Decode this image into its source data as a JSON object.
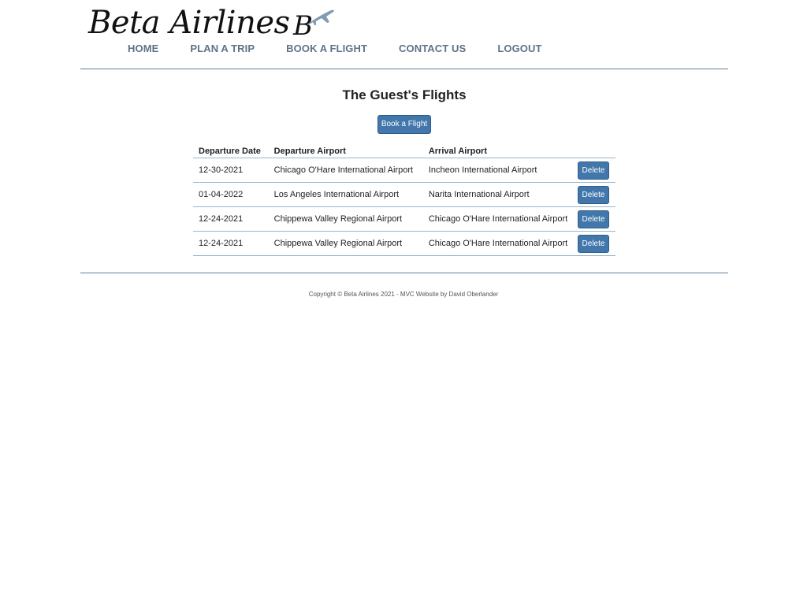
{
  "brand": {
    "logo_text": "Beta Airlines",
    "logo_mark": "B",
    "logo_mark_icon": "airplane-icon",
    "logo_color": "#111111"
  },
  "nav": {
    "items": [
      {
        "label": "HOME"
      },
      {
        "label": "PLAN A TRIP"
      },
      {
        "label": "BOOK A FLIGHT"
      },
      {
        "label": "CONTACT US"
      },
      {
        "label": "LOGOUT"
      }
    ],
    "color": "#5d7387"
  },
  "main": {
    "title": "The Guest's Flights",
    "book_button_label": "Book a Flight",
    "button_color": "#4277ab",
    "table": {
      "headers": [
        "Departure Date",
        "Departure Airport",
        "Arrival Airport"
      ],
      "rows": [
        {
          "date": "12-30-2021",
          "departure": "Chicago O'Hare International Airport",
          "arrival": "Incheon International Airport",
          "action": "Delete"
        },
        {
          "date": "01-04-2022",
          "departure": "Los Angeles International Airport",
          "arrival": "Narita International Airport",
          "action": "Delete"
        },
        {
          "date": "12-24-2021",
          "departure": "Chippewa Valley Regional Airport",
          "arrival": "Chicago O'Hare International Airport",
          "action": "Delete"
        },
        {
          "date": "12-24-2021",
          "departure": "Chippewa Valley Regional Airport",
          "arrival": "Chicago O'Hare International Airport",
          "action": "Delete"
        }
      ]
    }
  },
  "footer": {
    "text": "Copyright © Beta Airlines 2021 - MVC Website by David Oberlander"
  }
}
